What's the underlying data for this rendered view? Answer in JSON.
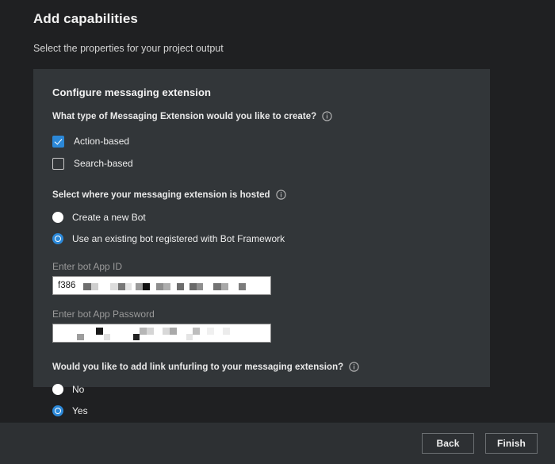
{
  "page": {
    "title": "Add capabilities",
    "subtitle": "Select the properties for your project output"
  },
  "panel": {
    "title": "Configure messaging extension",
    "questions": {
      "type": {
        "text": "What type of Messaging Extension would you like to create?",
        "info_icon": "info-circle-icon",
        "options": [
          {
            "label": "Action-based",
            "checked": true
          },
          {
            "label": "Search-based",
            "checked": false
          }
        ]
      },
      "hosting": {
        "text": "Select where your messaging extension is hosted",
        "info_icon": "info-circle-icon",
        "options": [
          {
            "label": "Create a new Bot",
            "selected": false
          },
          {
            "label": "Use an existing bot registered with Bot Framework",
            "selected": true
          }
        ]
      },
      "unfurling": {
        "text": "Would you like to add link unfurling to your messaging extension?",
        "info_icon": "info-circle-icon",
        "options": [
          {
            "label": "No",
            "selected": false
          },
          {
            "label": "Yes",
            "selected": true
          }
        ]
      }
    },
    "fields": [
      {
        "label": "Enter bot App ID",
        "value": "f386",
        "redacted": true
      },
      {
        "label": "Enter bot App Password",
        "value": "",
        "redacted": true
      }
    ]
  },
  "footer": {
    "back_label": "Back",
    "finish_label": "Finish"
  },
  "colors": {
    "background": "#1f2022",
    "panel": "#323639",
    "footer": "#2d3033",
    "accent": "#2b88d8",
    "text": "#e6e6e6",
    "muted": "#9a9a9a",
    "input_bg": "#ffffff"
  }
}
